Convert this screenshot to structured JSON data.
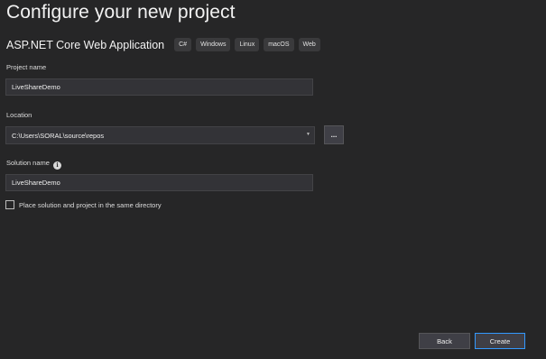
{
  "header": {
    "title": "Configure your new project"
  },
  "template": {
    "name": "ASP.NET Core Web Application",
    "tags": [
      "C#",
      "Windows",
      "Linux",
      "macOS",
      "Web"
    ]
  },
  "project_name": {
    "label": "Project name",
    "value": "LiveShareDemo"
  },
  "location": {
    "label": "Location",
    "value": "C:\\Users\\SORAL\\source\\repos",
    "browse_label": "..."
  },
  "solution_name": {
    "label": "Solution name",
    "info_icon": "info-icon",
    "value": "LiveShareDemo"
  },
  "same_directory": {
    "label": "Place solution and project in the same directory",
    "checked": false
  },
  "footer": {
    "back_label": "Back",
    "create_label": "Create"
  },
  "colors": {
    "background": "#262627",
    "input_background": "#333337",
    "button_background": "#3f3f46",
    "accent": "#3399ff"
  }
}
